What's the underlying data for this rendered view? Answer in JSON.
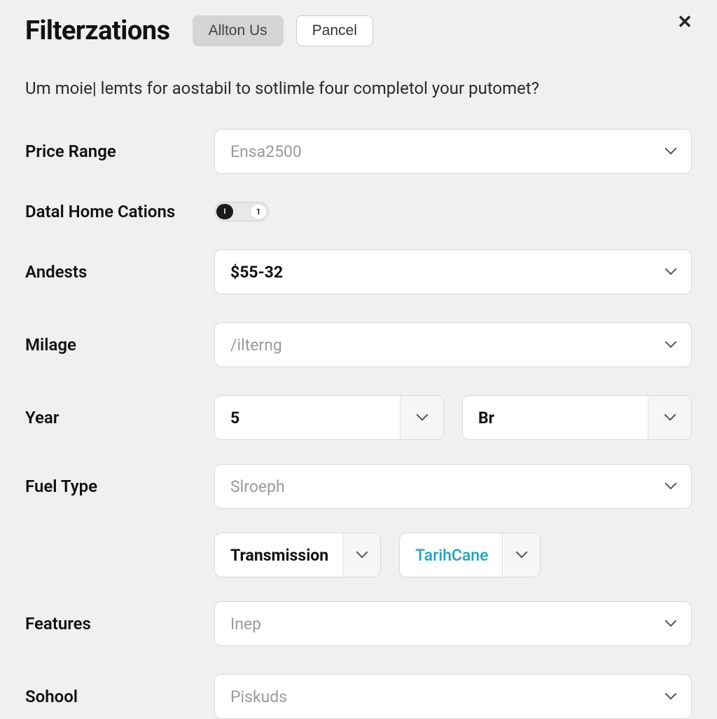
{
  "header": {
    "title": "Filterzations",
    "primary_btn": "Allton Us",
    "secondary_btn": "Pancel"
  },
  "subtitle": "Um moie| lemts for aostabil to sotlimle four completol your putomet?",
  "labels": {
    "price_range": "Price Range",
    "home_cations": "Datal Home Cations",
    "andests": "Andests",
    "milage": "Milage",
    "year": "Year",
    "fuel_type": "Fuel Type",
    "features": "Features",
    "sohool": "Sohool"
  },
  "values": {
    "price_range_placeholder": "Ensa2500",
    "andests_value": "$55-32",
    "milage_placeholder": "/ilterng",
    "year_from": "5",
    "year_to": "Br",
    "fuel_type_placeholder": "Slroeph",
    "transmission_label": "Transmission",
    "tarihcane": "TarihCane",
    "features_placeholder": "Inep",
    "sohool_placeholder": "Piskuds"
  },
  "toggle": {
    "left": "I",
    "right": "1"
  }
}
